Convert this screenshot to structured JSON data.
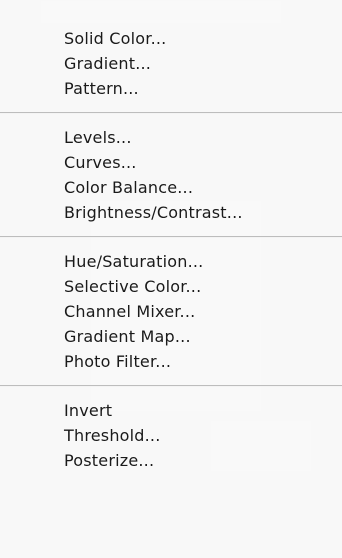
{
  "menu": {
    "groups": [
      {
        "items": [
          {
            "label": "Solid Color..."
          },
          {
            "label": "Gradient..."
          },
          {
            "label": "Pattern..."
          }
        ]
      },
      {
        "items": [
          {
            "label": "Levels..."
          },
          {
            "label": "Curves..."
          },
          {
            "label": "Color Balance..."
          },
          {
            "label": "Brightness/Contrast..."
          }
        ]
      },
      {
        "items": [
          {
            "label": "Hue/Saturation..."
          },
          {
            "label": "Selective Color..."
          },
          {
            "label": "Channel Mixer..."
          },
          {
            "label": "Gradient Map..."
          },
          {
            "label": "Photo Filter..."
          }
        ]
      },
      {
        "items": [
          {
            "label": "Invert"
          },
          {
            "label": "Threshold..."
          },
          {
            "label": "Posterize..."
          }
        ]
      }
    ]
  },
  "colors": {
    "menu_background": "#fafafa",
    "separator": "#bdbdbd",
    "text": "#1a1a1a",
    "highlight": "#3875d7"
  }
}
